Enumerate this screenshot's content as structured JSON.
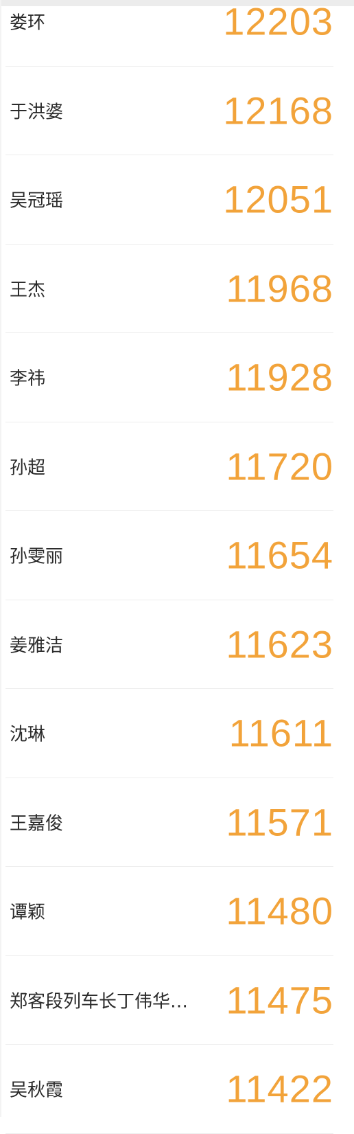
{
  "leaderboard": {
    "rows": [
      {
        "name": "娄环",
        "score": "12203"
      },
      {
        "name": "于洪婆",
        "score": "12168"
      },
      {
        "name": "吴冠瑶",
        "score": "12051"
      },
      {
        "name": "王杰",
        "score": "11968"
      },
      {
        "name": "李祎",
        "score": "11928"
      },
      {
        "name": "孙超",
        "score": "11720"
      },
      {
        "name": "孙雯丽",
        "score": "11654"
      },
      {
        "name": "姜雅洁",
        "score": "11623"
      },
      {
        "name": "沈琳",
        "score": "11611"
      },
      {
        "name": "王嘉俊",
        "score": "11571"
      },
      {
        "name": "谭颖",
        "score": "11480"
      },
      {
        "name": "郑客段列车长丁伟华…",
        "score": "11475"
      },
      {
        "name": "吴秋霞",
        "score": "11422"
      }
    ]
  },
  "colors": {
    "score": "#f2a33a",
    "name": "#2b2b2b",
    "divider": "#ededed"
  }
}
